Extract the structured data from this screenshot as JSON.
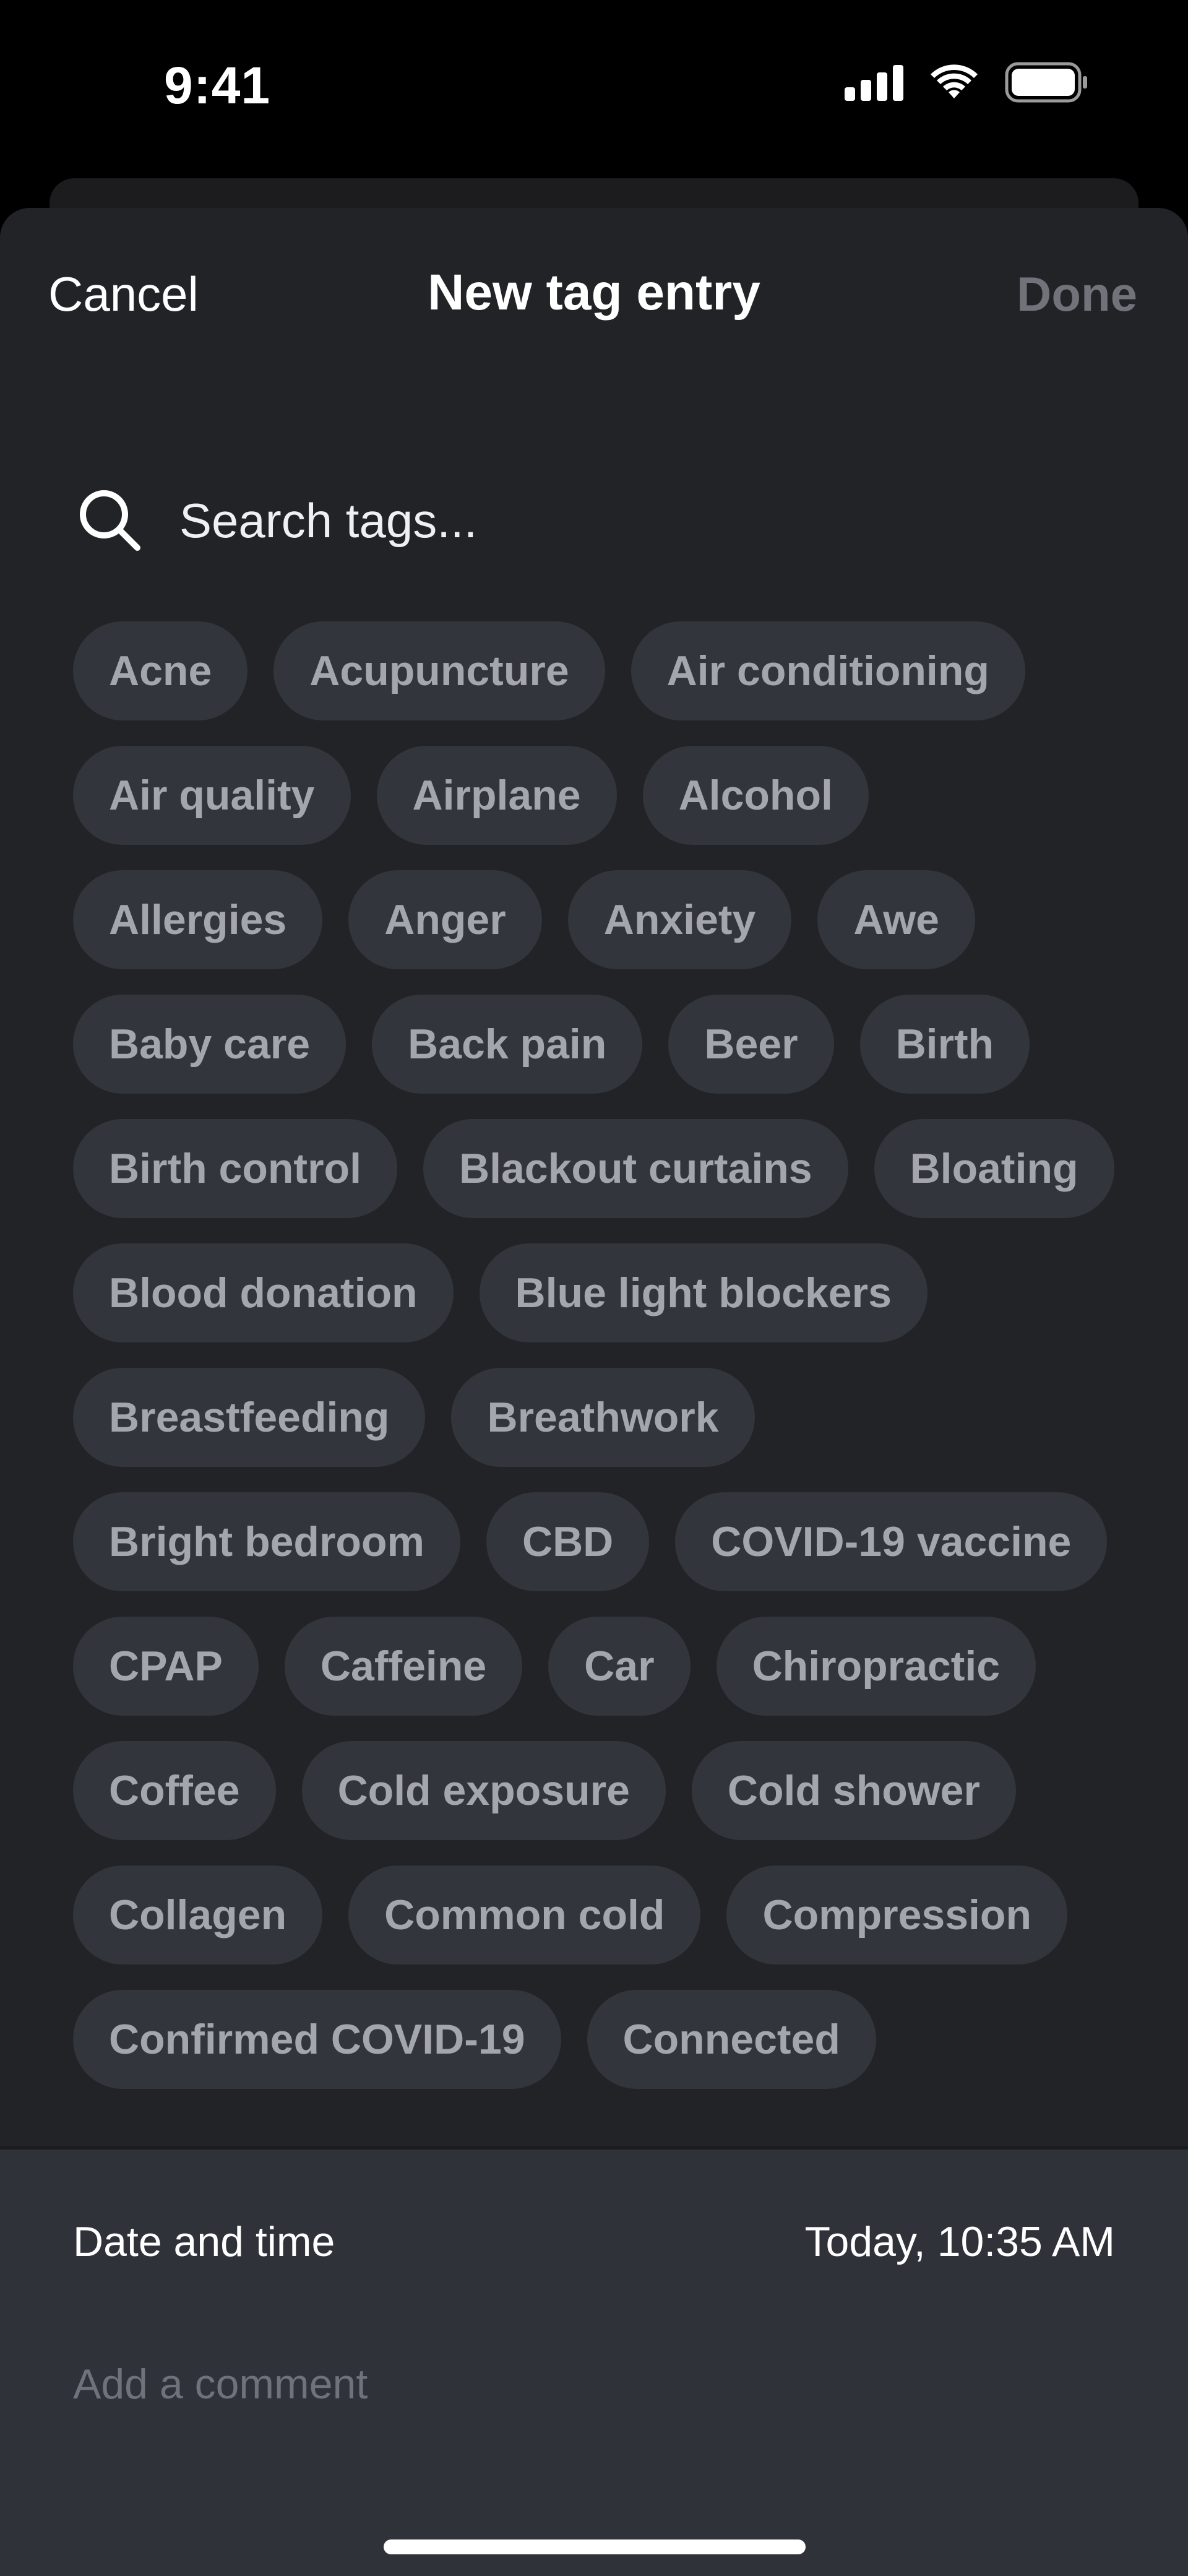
{
  "status_bar": {
    "time": "9:41",
    "icons": [
      "cellular-signal-icon",
      "wifi-icon",
      "battery-icon"
    ]
  },
  "nav": {
    "cancel_label": "Cancel",
    "title": "New tag entry",
    "done_label": "Done"
  },
  "search": {
    "placeholder": "Search tags...",
    "value": ""
  },
  "tag_rows": [
    [
      "Acne",
      "Acupuncture",
      "Air conditioning"
    ],
    [
      "Air quality",
      "Airplane",
      "Alcohol"
    ],
    [
      "Allergies",
      "Anger",
      "Anxiety",
      "Awe"
    ],
    [
      "Baby care",
      "Back pain",
      "Beer",
      "Birth"
    ],
    [
      "Birth control",
      "Blackout curtains",
      "Bloating"
    ],
    [
      "Blood donation",
      "Blue light blockers"
    ],
    [
      "Breastfeeding",
      "Breathwork"
    ],
    [
      "Bright bedroom",
      "CBD",
      "COVID-19 vaccine"
    ],
    [
      "CPAP",
      "Caffeine",
      "Car",
      "Chiropractic"
    ],
    [
      "Coffee",
      "Cold exposure",
      "Cold shower"
    ],
    [
      "Collagen",
      "Common cold",
      "Compression"
    ],
    [
      "Confirmed COVID-19",
      "Connected"
    ]
  ],
  "footer": {
    "date_label": "Date and time",
    "date_value": "Today, 10:35 AM",
    "comment_placeholder": "Add a comment"
  },
  "colors": {
    "background": "#000000",
    "sheet": "#222327",
    "tag_bg": "#33353c",
    "tag_text": "#a4a6ad",
    "panel": "#30323a",
    "done_disabled": "#70737a"
  }
}
